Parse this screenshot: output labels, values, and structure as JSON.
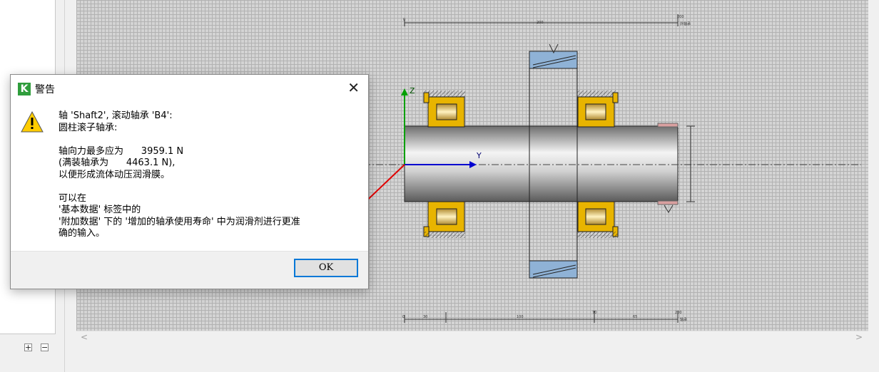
{
  "dialog": {
    "title": "警告",
    "app_icon_letter": "K",
    "close_glyph": "✕",
    "message": "轴 'Shaft2', 滚动轴承 'B4':\n圆柱滚子轴承:\n\n轴向力最多应为      3959.1 N\n(满装轴承为      4463.1 N),\n以便形成流体动压润滑膜。\n\n可以在\n'基本数据' 标签中的\n'附加数据' 下的 '增加的轴承使用寿命' 中为润滑剂进行更准\n确的输入。",
    "ok_label": "OK"
  },
  "tree_buttons": {
    "expand": "+",
    "collapse": "−"
  },
  "scrollbar": {
    "left_arrow": "<",
    "right_arrow": ">"
  },
  "drawing": {
    "axis_z_label": "Z",
    "axis_y_label": "Y",
    "dim_top_left": "0",
    "dim_top_mid": "200",
    "dim_top_right": "200",
    "dim_top_unit": "外轴承",
    "dim_bottom": [
      "0",
      "30",
      "100",
      "70",
      "65",
      "200"
    ],
    "dim_bottom_unit": "轴承",
    "colors": {
      "shaft": "#c8c8c8",
      "bearing": "#e8b400",
      "gear": "#8fb2d6",
      "axis_y": "#0000d0",
      "axis_z": "#00a000",
      "axis_x": "#e00000"
    }
  }
}
